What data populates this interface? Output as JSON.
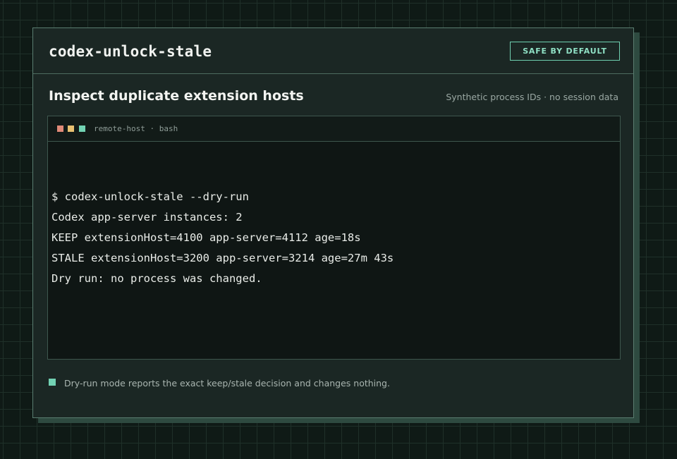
{
  "app": {
    "title": "codex-unlock-stale",
    "badge": "SAFE BY DEFAULT"
  },
  "section": {
    "title": "Inspect duplicate extension hosts",
    "meta": "Synthetic process IDs · no session data"
  },
  "terminal": {
    "label": "remote-host · bash",
    "lines": [
      "$ codex-unlock-stale --dry-run",
      "Codex app-server instances: 2",
      "KEEP extensionHost=4100 app-server=4112 age=18s",
      "STALE extensionHost=3200 app-server=3214 age=27m 43s",
      "Dry run: no process was changed."
    ]
  },
  "footer": {
    "note": "Dry-run mode reports the exact keep/stale decision and changes nothing."
  },
  "colors": {
    "accent": "#72d2b3",
    "dot_red": "#e08a78",
    "dot_yellow": "#e8c071",
    "dot_green": "#72d2b3"
  }
}
